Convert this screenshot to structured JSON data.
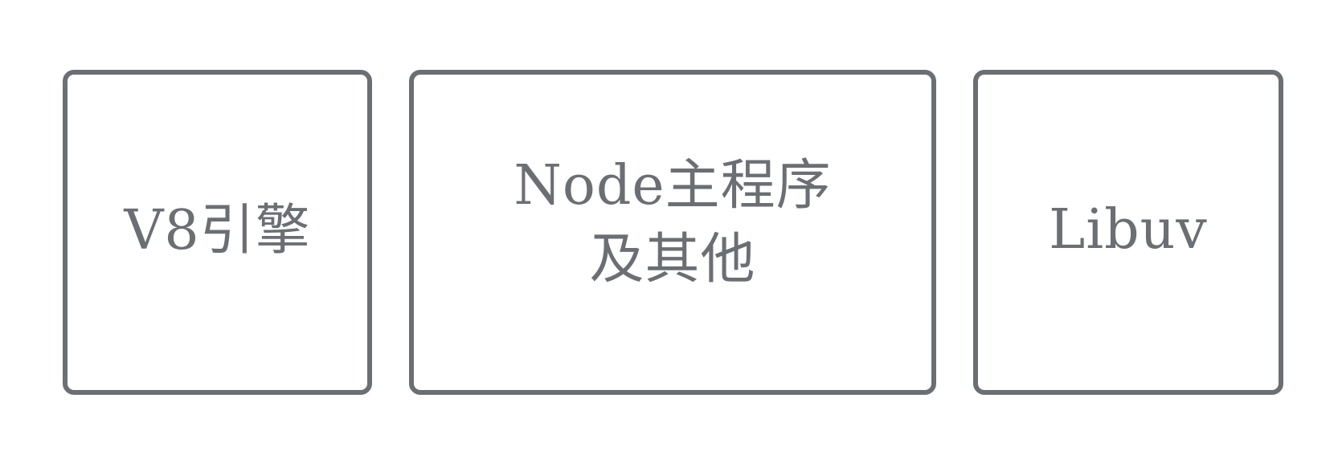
{
  "diagram": {
    "boxes": [
      {
        "label": "V8引擎"
      },
      {
        "label": "Node主程序\n及其他"
      },
      {
        "label": "Libuv"
      }
    ]
  },
  "colors": {
    "border": "#6b6f74",
    "text": "#6b6f74",
    "background": "#ffffff"
  }
}
